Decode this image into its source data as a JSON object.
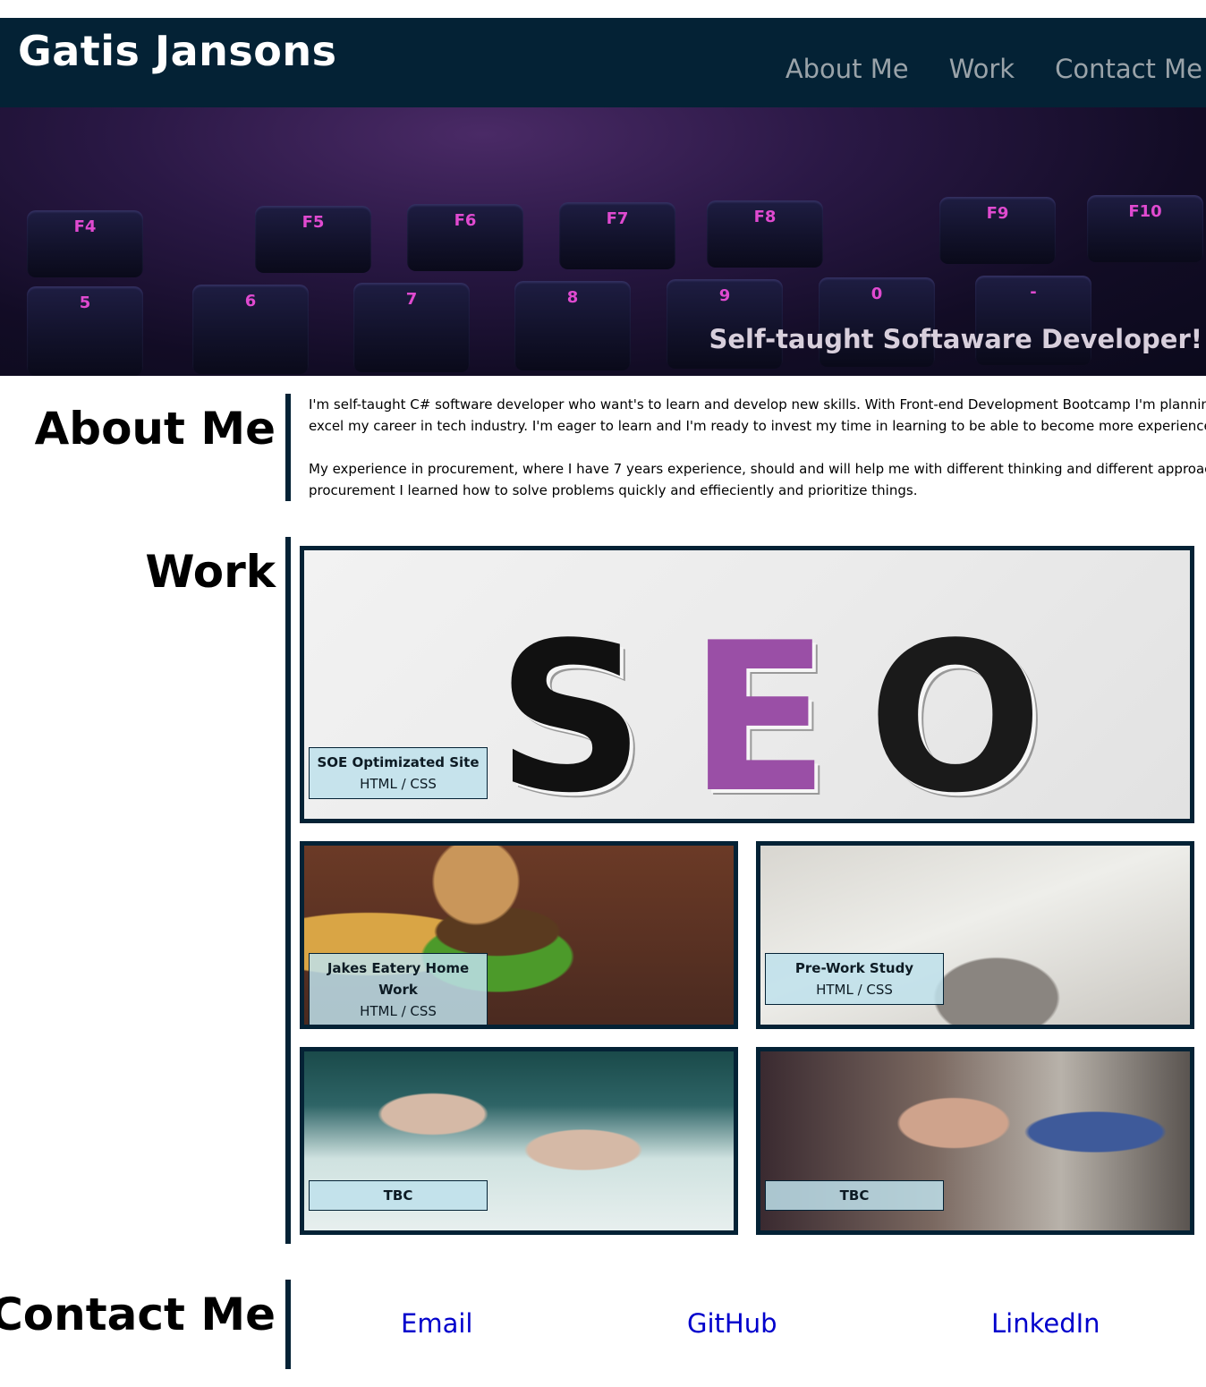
{
  "header": {
    "brand": "Gatis Jansons",
    "nav": [
      "About Me",
      "Work",
      "Contact Me"
    ]
  },
  "hero": {
    "caption": "Self-taught Softaware Developer!",
    "keys": [
      "F4",
      "F5",
      "F6",
      "F7",
      "F8",
      "F9",
      "F10",
      "5",
      "6",
      "7",
      "8",
      "9",
      "0",
      "-"
    ]
  },
  "about": {
    "title": "About Me",
    "p1_line1": "I'm self-taught C# software developer who want's to learn and develop new skills. With Front-end Development Bootcamp I'm planning to",
    "p1_line2": "excel my career in tech industry. I'm eager to learn and I'm ready to invest my time in learning to be able to become more experienced.",
    "p2_line1": "My experience in procurement, where I have 7 years experience, should and will help me with different thinking and different approach. In",
    "p2_line2": "procurement I learned how to solve problems quickly and effieciently and prioritize things."
  },
  "work": {
    "title": "Work",
    "seo_letters": [
      "S",
      "E",
      "O"
    ],
    "cards": [
      {
        "title": "SOE Optimizated Site",
        "subtitle": "HTML / CSS"
      },
      {
        "title": "Jakes Eatery Home Work",
        "subtitle": "HTML / CSS"
      },
      {
        "title": "Pre-Work Study",
        "subtitle": "HTML / CSS"
      },
      {
        "title": "TBC",
        "subtitle": ""
      },
      {
        "title": "TBC",
        "subtitle": ""
      }
    ]
  },
  "contact": {
    "title": "Contact Me",
    "links": [
      "Email",
      "GitHub",
      "LinkedIn"
    ]
  },
  "colors": {
    "header_bg": "#042235",
    "nav_text": "#9aa3a9",
    "label_bg": "#bee1eb",
    "link": "#0000cc",
    "key_glyph": "#e04ad0"
  }
}
